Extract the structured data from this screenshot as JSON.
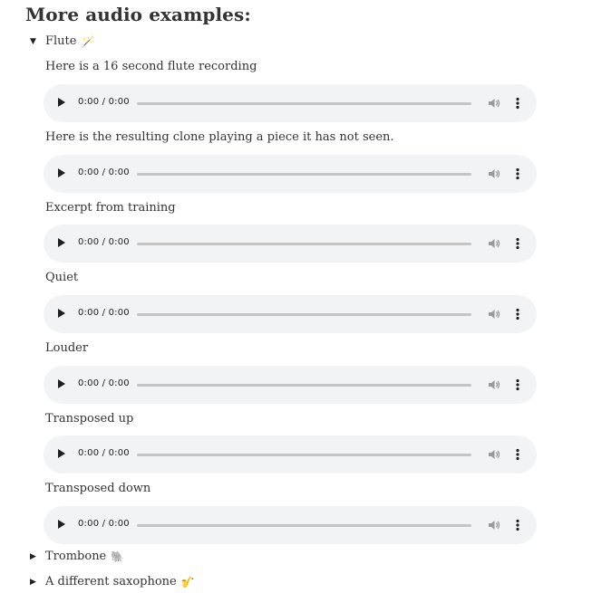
{
  "heading": "More audio examples:",
  "sections": {
    "flute": {
      "label": "Flute",
      "emoji": "🪄",
      "expanded": true
    },
    "trombone": {
      "label": "Trombone",
      "emoji": "🐘",
      "expanded": false
    },
    "saxophone": {
      "label": "A different saxophone",
      "emoji": "🎷",
      "expanded": false
    }
  },
  "markers": {
    "expanded": "▼",
    "collapsed": "▶"
  },
  "flute_examples": [
    {
      "caption": "Here is a 16 second flute recording",
      "time": "0:00 / 0:00"
    },
    {
      "caption": "Here is the resulting clone playing a piece it has not seen.",
      "time": "0:00 / 0:00"
    },
    {
      "caption": "Excerpt from training",
      "time": "0:00 / 0:00"
    },
    {
      "caption": "Quiet",
      "time": "0:00 / 0:00"
    },
    {
      "caption": "Louder",
      "time": "0:00 / 0:00"
    },
    {
      "caption": "Transposed up",
      "time": "0:00 / 0:00"
    },
    {
      "caption": "Transposed down",
      "time": "0:00 / 0:00"
    }
  ],
  "player_icons": {
    "play": "play-icon",
    "volume": "volume-icon",
    "menu": "more-options-icon"
  },
  "colors": {
    "player_bg": "#f1f3f4",
    "track": "#c4c4c4",
    "icon": "#1f1f1f",
    "text": "#333333"
  }
}
